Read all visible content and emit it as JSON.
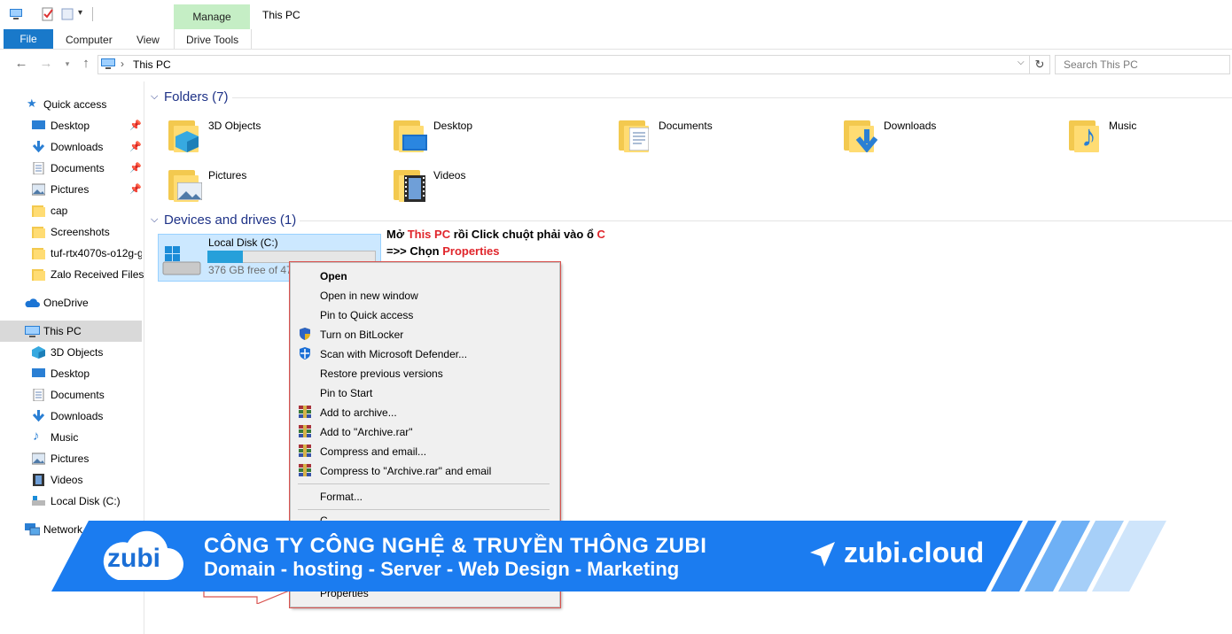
{
  "window": {
    "title": "This PC"
  },
  "ribbon": {
    "contextual_tab": "Manage",
    "tabs": [
      "File",
      "Computer",
      "View",
      "Drive Tools"
    ]
  },
  "address": {
    "path": "This PC",
    "search_placeholder": "Search This PC"
  },
  "sidebar": {
    "quick_access": "Quick access",
    "quick_items": [
      "Desktop",
      "Downloads",
      "Documents",
      "Pictures",
      "cap",
      "Screenshots",
      "tuf-rtx4070s-o12g-g",
      "Zalo Received Files"
    ],
    "onedrive": "OneDrive",
    "this_pc": "This PC",
    "pc_items": [
      "3D Objects",
      "Desktop",
      "Documents",
      "Downloads",
      "Music",
      "Pictures",
      "Videos",
      "Local Disk (C:)"
    ],
    "network": "Network"
  },
  "main": {
    "folders_header": "Folders (7)",
    "folders": [
      "3D Objects",
      "Desktop",
      "Documents",
      "Downloads",
      "Music",
      "Pictures",
      "Videos"
    ],
    "devices_header": "Devices and drives (1)",
    "drive": {
      "name": "Local Disk (C:)",
      "free_text": "376 GB free of 476",
      "used_fraction": 0.21
    }
  },
  "annotation": {
    "line1_a": "Mở ",
    "line1_b": "This PC",
    "line1_c": " rồi Click chuột phải vào ổ ",
    "line1_d": "C",
    "line2_a": "=>> Chọn ",
    "line2_b": "Properties"
  },
  "context_menu": {
    "items": [
      "Open",
      "Open in new window",
      "Pin to Quick access",
      "Turn on BitLocker",
      "Scan with Microsoft Defender...",
      "Restore previous versions",
      "Pin to Start",
      "Add to archive...",
      "Add to \"Archive.rar\"",
      "Compress and email...",
      "Compress to \"Archive.rar\" and email"
    ],
    "format": "Format...",
    "partial": "C",
    "properties": "Properties"
  },
  "banner": {
    "logo": "zubi",
    "line1": "CÔNG TY CÔNG NGHỆ & TRUYỀN THÔNG ZUBI",
    "line2": "Domain - hosting - Server - Web Design - Marketing",
    "url": "zubi.cloud",
    "color": "#1b7cf0"
  }
}
